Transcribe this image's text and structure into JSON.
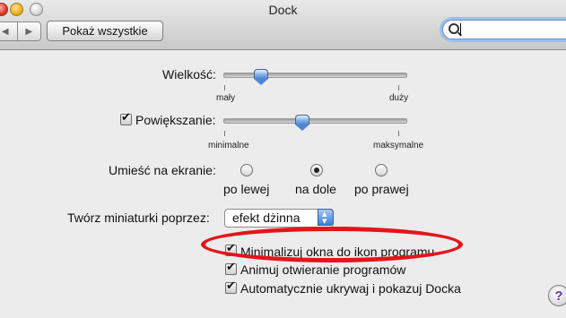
{
  "window": {
    "title": "Dock"
  },
  "toolbar": {
    "back": "◀",
    "forward": "▶",
    "show_all": "Pokaż wszystkie",
    "search_value": ""
  },
  "size": {
    "label": "Wielkość:",
    "min_label": "mały",
    "max_label": "duży",
    "value_fraction": 0.2
  },
  "magnification": {
    "label": "Powiększanie:",
    "checked": true,
    "min_label": "minimalne",
    "max_label": "maksymalne",
    "value_fraction": 0.43
  },
  "position": {
    "label": "Umieść na ekranie:",
    "options": [
      "po lewej",
      "na dole",
      "po prawej"
    ],
    "selected": "na dole"
  },
  "minimize_effect": {
    "label": "Twórz miniaturki poprzez:",
    "value": "efekt dżinna",
    "stepper_up": "▲",
    "stepper_down": "▼"
  },
  "checkboxes": [
    {
      "label": "Minimalizuj okna do ikon programu",
      "checked": true
    },
    {
      "label": "Animuj otwieranie programów",
      "checked": true
    },
    {
      "label": "Automatycznie ukrywaj i pokazuj Docka",
      "checked": true
    }
  ],
  "help": {
    "symbol": "?"
  },
  "colors": {
    "annotation": "#e4151a",
    "accent": "#3b7ee0"
  }
}
